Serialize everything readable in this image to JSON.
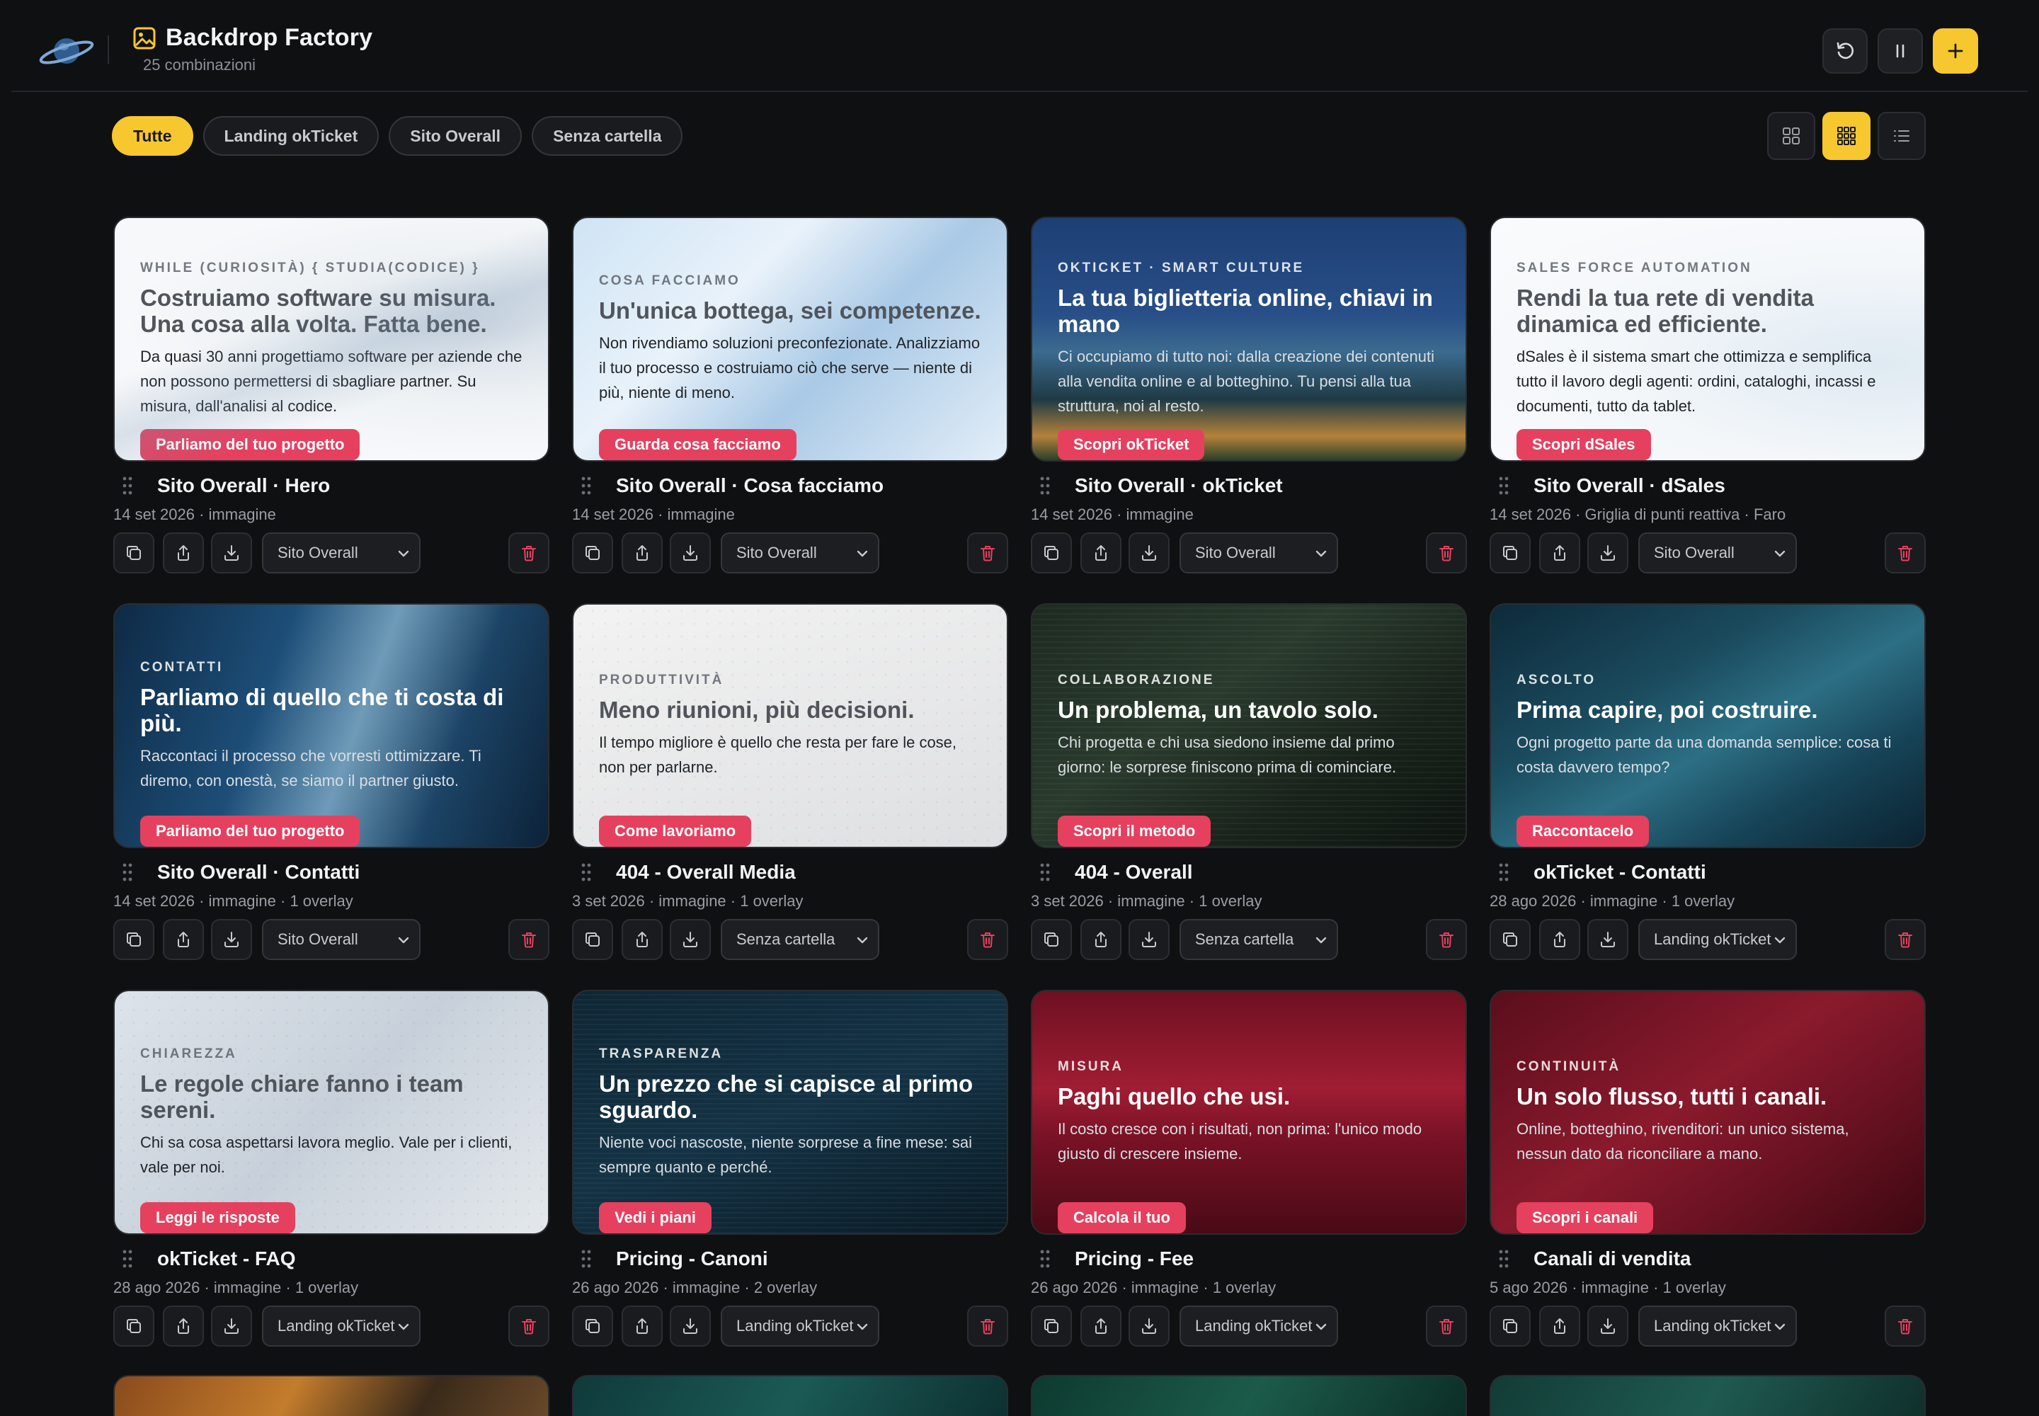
{
  "app": {
    "title": "Backdrop Factory",
    "subtitle": "25 combinazioni"
  },
  "header_buttons": [
    "reset-icon",
    "pause-icon",
    "plus-icon"
  ],
  "filters": [
    {
      "label": "Tutte",
      "active": true
    },
    {
      "label": "Landing okTicket",
      "active": false
    },
    {
      "label": "Sito Overall",
      "active": false
    },
    {
      "label": "Senza cartella",
      "active": false
    }
  ],
  "view_modes": [
    "grid-large-icon",
    "grid-small-icon",
    "list-icon"
  ],
  "accent": "#f7c72f",
  "cta_color": "#e6405f",
  "cards": [
    {
      "eyebrow": "WHILE (CURIOSITÀ) { STUDIA(CODICE) }",
      "headline": "Costruiamo software su misura. Una cosa alla volta. Fatta bene.",
      "body": "Da quasi 30 anni progettiamo software per aziende che non possono permettersi di sbagliare partner. Su misura, dall'analisi al codice.",
      "cta": "Parliamo del tuo progetto",
      "name": "Sito Overall · Hero",
      "meta": "14 set 2026 · immagine",
      "folder": "Sito Overall"
    },
    {
      "eyebrow": "COSA FACCIAMO",
      "headline": "Un'unica bottega, sei competenze.",
      "body": "Non rivendiamo soluzioni preconfezionate. Analizziamo il tuo processo e costruiamo ciò che serve — niente di più, niente di meno.",
      "cta": "Guarda cosa facciamo",
      "name": "Sito Overall · Cosa facciamo",
      "meta": "14 set 2026 · immagine",
      "folder": "Sito Overall"
    },
    {
      "eyebrow": "OKTICKET · SMART CULTURE",
      "headline": "La tua biglietteria online, chiavi in mano",
      "body": "Ci occupiamo di tutto noi: dalla creazione dei contenuti alla vendita online e al botteghino. Tu pensi alla tua struttura, noi al resto.",
      "cta": "Scopri okTicket",
      "name": "Sito Overall · okTicket",
      "meta": "14 set 2026 · immagine",
      "folder": "Sito Overall"
    },
    {
      "eyebrow": "SALES FORCE AUTOMATION",
      "headline": "Rendi la tua rete di vendita dinamica ed efficiente.",
      "body": "dSales è il sistema smart che ottimizza e semplifica tutto il lavoro degli agenti: ordini, cataloghi, incassi e documenti, tutto da tablet.",
      "cta": "Scopri dSales",
      "name": "Sito Overall · dSales",
      "meta": "14 set 2026 · Griglia di punti reattiva · Faro",
      "folder": "Sito Overall"
    },
    {
      "eyebrow": "CONTATTI",
      "headline": "Parliamo di quello che ti costa di più.",
      "body": "Raccontaci il processo che vorresti ottimizzare. Ti diremo, con onestà, se siamo il partner giusto.",
      "cta": "Parliamo del tuo progetto",
      "name": "Sito Overall · Contatti",
      "meta": "14 set 2026 · immagine · 1 overlay",
      "folder": "Sito Overall"
    },
    {
      "eyebrow": "PRODUTTIVITÀ",
      "headline": "Meno riunioni, più decisioni.",
      "body": "Il tempo migliore è quello che resta per fare le cose, non per parlarne.",
      "cta": "Come lavoriamo",
      "name": "404 - Overall Media",
      "meta": "3 set 2026 · immagine · 1 overlay",
      "folder": "Senza cartella"
    },
    {
      "eyebrow": "COLLABORAZIONE",
      "headline": "Un problema, un tavolo solo.",
      "body": "Chi progetta e chi usa siedono insieme dal primo giorno: le sorprese finiscono prima di cominciare.",
      "cta": "Scopri il metodo",
      "name": "404 - Overall",
      "meta": "3 set 2026 · immagine · 1 overlay",
      "folder": "Senza cartella"
    },
    {
      "eyebrow": "ASCOLTO",
      "headline": "Prima capire, poi costruire.",
      "body": "Ogni progetto parte da una domanda semplice: cosa ti costa davvero tempo?",
      "cta": "Raccontacelo",
      "name": "okTicket - Contatti",
      "meta": "28 ago 2026 · immagine · 1 overlay",
      "folder": "Landing okTicket"
    },
    {
      "eyebrow": "CHIAREZZA",
      "headline": "Le regole chiare fanno i team sereni.",
      "body": "Chi sa cosa aspettarsi lavora meglio. Vale per i clienti, vale per noi.",
      "cta": "Leggi le risposte",
      "name": "okTicket - FAQ",
      "meta": "28 ago 2026 · immagine · 1 overlay",
      "folder": "Landing okTicket"
    },
    {
      "eyebrow": "TRASPARENZA",
      "headline": "Un prezzo che si capisce al primo sguardo.",
      "body": "Niente voci nascoste, niente sorprese a fine mese: sai sempre quanto e perché.",
      "cta": "Vedi i piani",
      "name": "Pricing - Canoni",
      "meta": "26 ago 2026 · immagine · 2 overlay",
      "folder": "Landing okTicket"
    },
    {
      "eyebrow": "MISURA",
      "headline": "Paghi quello che usi.",
      "body": "Il costo cresce con i risultati, non prima: l'unico modo giusto di crescere insieme.",
      "cta": "Calcola il tuo",
      "name": "Pricing - Fee",
      "meta": "26 ago 2026 · immagine · 1 overlay",
      "folder": "Landing okTicket"
    },
    {
      "eyebrow": "CONTINUITÀ",
      "headline": "Un solo flusso, tutti i canali.",
      "body": "Online, botteghino, rivenditori: un unico sistema, nessun dato da riconciliare a mano.",
      "cta": "Scopri i canali",
      "name": "Canali di vendita",
      "meta": "5 ago 2026 · immagine · 1 overlay",
      "folder": "Landing okTicket"
    }
  ]
}
